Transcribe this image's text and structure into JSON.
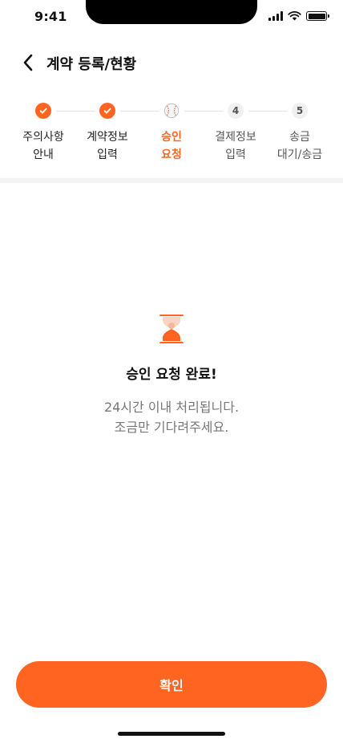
{
  "status_bar": {
    "time": "9:41"
  },
  "header": {
    "title": "계약 등록/현황",
    "back_icon": "chevron-left-icon"
  },
  "stepper": {
    "accent_color": "#ff6420",
    "steps": [
      {
        "label": "주의사항\n안내",
        "state": "done",
        "marker": ""
      },
      {
        "label": "계약정보\n입력",
        "state": "done",
        "marker": ""
      },
      {
        "label": "승인\n요청",
        "state": "current",
        "marker": ""
      },
      {
        "label": "결제정보\n입력",
        "state": "pending",
        "marker": "4"
      },
      {
        "label": "송금\n대기/송금",
        "state": "pending",
        "marker": "5"
      }
    ]
  },
  "result": {
    "icon": "hourglass-icon",
    "title": "승인 요청 완료!",
    "description": "24시간 이내 처리됩니다.\n조금만 기다려주세요."
  },
  "actions": {
    "confirm_label": "확인"
  }
}
